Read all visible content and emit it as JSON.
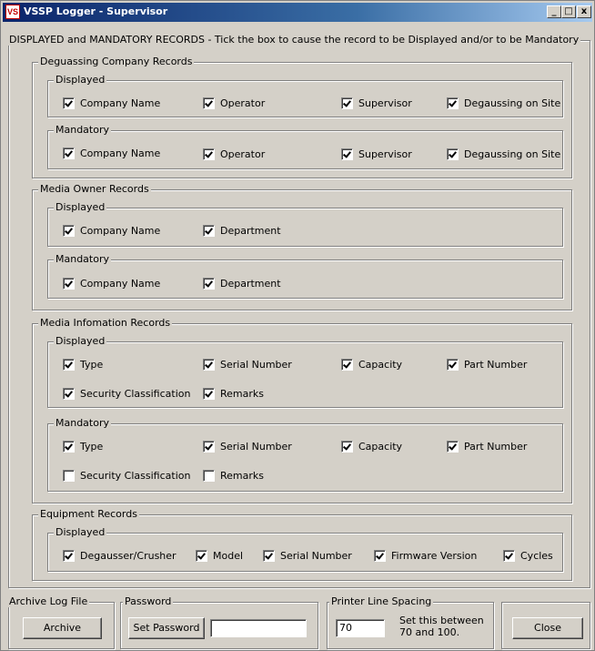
{
  "window": {
    "title": "VSSP Logger - Supervisor",
    "icon_text": "VS",
    "controls": {
      "minimize": "_",
      "maximize": "□",
      "close": "x"
    }
  },
  "main_group": {
    "label": "DISPLAYED and MANDATORY RECORDS - Tick the box to cause the record to be Displayed and/or to be Mandatory"
  },
  "degaussing": {
    "label": "Deguassing Company Records",
    "displayed": {
      "label": "Displayed",
      "items": [
        {
          "label": "Company Name",
          "checked": true
        },
        {
          "label": "Operator",
          "checked": true
        },
        {
          "label": "Supervisor",
          "checked": true
        },
        {
          "label": "Degaussing on Site",
          "checked": true
        }
      ]
    },
    "mandatory": {
      "label": "Mandatory",
      "items": [
        {
          "label": "Company Name",
          "checked": true
        },
        {
          "label": "Operator",
          "checked": true
        },
        {
          "label": "Supervisor",
          "checked": true
        },
        {
          "label": "Degaussing on Site",
          "checked": true
        }
      ]
    }
  },
  "media_owner": {
    "label": "Media Owner Records",
    "displayed": {
      "label": "Displayed",
      "items": [
        {
          "label": "Company Name",
          "checked": true
        },
        {
          "label": "Department",
          "checked": true
        }
      ]
    },
    "mandatory": {
      "label": "Mandatory",
      "items": [
        {
          "label": "Company Name",
          "checked": true
        },
        {
          "label": "Department",
          "checked": true
        }
      ]
    }
  },
  "media_info": {
    "label": "Media Infomation Records",
    "displayed": {
      "label": "Displayed",
      "items": [
        {
          "label": "Type",
          "checked": true
        },
        {
          "label": "Serial Number",
          "checked": true
        },
        {
          "label": "Capacity",
          "checked": true
        },
        {
          "label": "Part Number",
          "checked": true
        },
        {
          "label": "Security Classification",
          "checked": true
        },
        {
          "label": "Remarks",
          "checked": true
        }
      ]
    },
    "mandatory": {
      "label": "Mandatory",
      "items": [
        {
          "label": "Type",
          "checked": true
        },
        {
          "label": "Serial Number",
          "checked": true
        },
        {
          "label": "Capacity",
          "checked": true
        },
        {
          "label": "Part Number",
          "checked": true
        },
        {
          "label": "Security Classification",
          "checked": false
        },
        {
          "label": "Remarks",
          "checked": false
        }
      ]
    }
  },
  "equipment": {
    "label": "Equipment Records",
    "displayed": {
      "label": "Displayed",
      "items": [
        {
          "label": "Degausser/Crusher",
          "checked": true
        },
        {
          "label": "Model",
          "checked": true
        },
        {
          "label": "Serial Number",
          "checked": true
        },
        {
          "label": "Firmware Version",
          "checked": true
        },
        {
          "label": "Cycles",
          "checked": true
        }
      ]
    }
  },
  "archive": {
    "label": "Archive Log File",
    "button": "Archive"
  },
  "password": {
    "label": "Password",
    "button": "Set Password",
    "value": ""
  },
  "printer": {
    "label": "Printer Line Spacing",
    "value": "70",
    "hint_line1": "Set this between",
    "hint_line2": "70 and 100."
  },
  "close_button": "Close",
  "colors": {
    "title_start": "#0a246a",
    "title_end": "#a6caf0",
    "face": "#d4d0c8"
  }
}
